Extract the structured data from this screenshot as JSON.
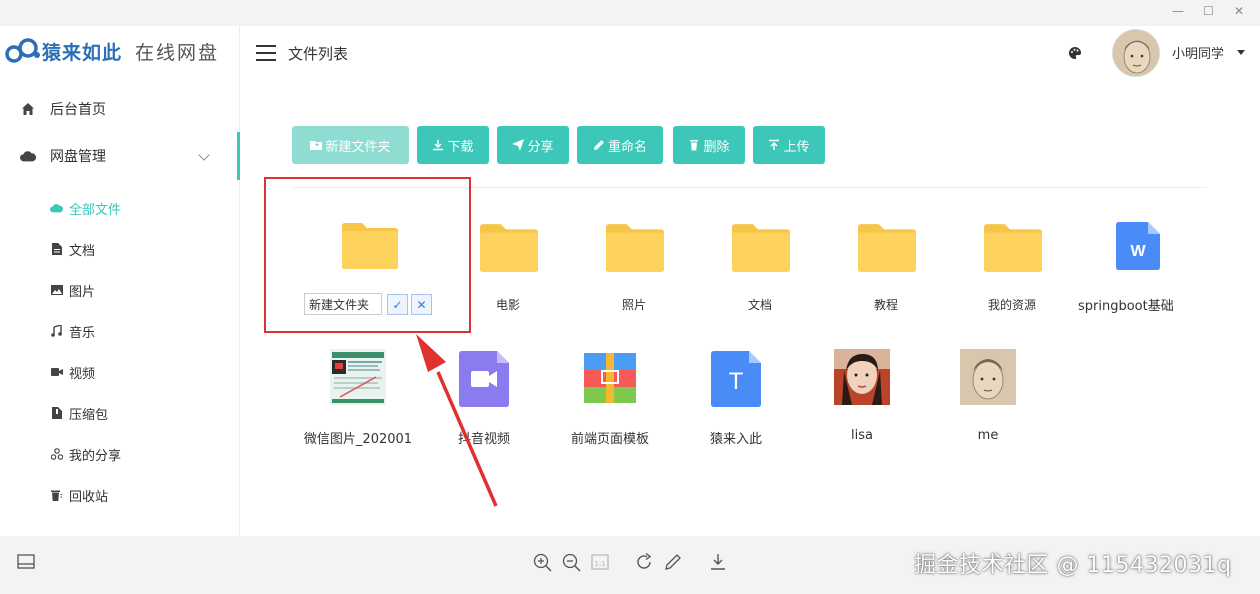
{
  "window": {
    "minimize": "—",
    "maximize": "☐",
    "close": "✕"
  },
  "logo": {
    "main": "猿来如此",
    "sub": "在线网盘"
  },
  "sidebar": {
    "home_label": "后台首页",
    "disk_label": "网盘管理",
    "sub_items": [
      {
        "label": "全部文件",
        "icon": "cloud-icon",
        "active": true
      },
      {
        "label": "文档",
        "icon": "document-icon"
      },
      {
        "label": "图片",
        "icon": "image-icon"
      },
      {
        "label": "音乐",
        "icon": "music-icon"
      },
      {
        "label": "视频",
        "icon": "video-icon"
      },
      {
        "label": "压缩包",
        "icon": "archive-icon"
      },
      {
        "label": "我的分享",
        "icon": "share-icon"
      },
      {
        "label": "回收站",
        "icon": "trash-icon"
      }
    ]
  },
  "header": {
    "title": "文件列表",
    "username": "小明同学"
  },
  "toolbar": {
    "new_folder": "新建文件夹",
    "download": "下载",
    "share": "分享",
    "rename": "重命名",
    "delete": "删除",
    "upload": "上传"
  },
  "rename": {
    "value": "新建文件夹",
    "ok": "✓",
    "cancel": "✕"
  },
  "files": [
    {
      "name": "电影",
      "type": "folder"
    },
    {
      "name": "照片",
      "type": "folder"
    },
    {
      "name": "文档",
      "type": "folder"
    },
    {
      "name": "教程",
      "type": "folder"
    },
    {
      "name": "我的资源",
      "type": "folder"
    },
    {
      "name": "springboot基础",
      "type": "word"
    },
    {
      "name": "微信图片_202001",
      "type": "image-screenshot"
    },
    {
      "name": "抖音视频",
      "type": "video"
    },
    {
      "name": "前端页面模板",
      "type": "archive"
    },
    {
      "name": "猿来入此",
      "type": "text"
    },
    {
      "name": "lisa",
      "type": "photo"
    },
    {
      "name": "me",
      "type": "photo"
    }
  ],
  "watermark": "掘金技术社区 @ 115432031q",
  "colors": {
    "accent": "#3cc7b8",
    "folder": "#fdd35e",
    "annotation": "#e03131"
  }
}
